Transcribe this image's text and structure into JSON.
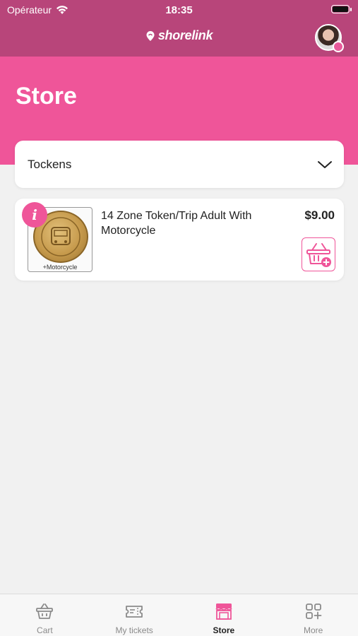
{
  "status_bar": {
    "carrier": "Opérateur",
    "time": "18:35"
  },
  "header": {
    "logo_text": "shorelink"
  },
  "page": {
    "title": "Store"
  },
  "category_select": {
    "value": "Tockens"
  },
  "products": [
    {
      "name": "14 Zone Token/Trip Adult With Motorcycle",
      "price": "$9.00",
      "image_caption": "+Motorcycle",
      "info_badge": "i"
    }
  ],
  "tabs": [
    {
      "label": "Cart",
      "icon": "basket-icon",
      "active": false
    },
    {
      "label": "My tickets",
      "icon": "ticket-icon",
      "active": false
    },
    {
      "label": "Store",
      "icon": "store-icon",
      "active": true
    },
    {
      "label": "More",
      "icon": "grid-plus-icon",
      "active": false
    }
  ],
  "colors": {
    "header": "#b8457a",
    "accent": "#ef5599",
    "background": "#f1f1f1"
  }
}
